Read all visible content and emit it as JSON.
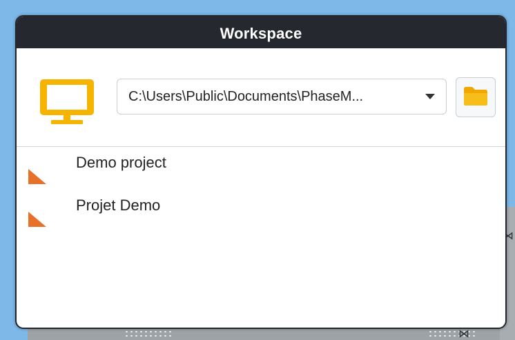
{
  "window": {
    "title": "Workspace"
  },
  "workspace_selector": {
    "selected_path": "C:\\Users\\Public\\Documents\\PhaseM..."
  },
  "projects": [
    {
      "name": "Demo project"
    },
    {
      "name": "Projet Demo"
    }
  ],
  "icons": {
    "workspace": "monitor-icon",
    "dropdown": "caret-down-icon",
    "browse": "folder-icon",
    "project": "project-corner-icon"
  },
  "colors": {
    "title_bar": "#25282e",
    "monitor_icon": "#f4b400",
    "folder_icon": "#f4b400",
    "project_icon": "#e8712a",
    "desktop_background": "#7db8e8"
  }
}
